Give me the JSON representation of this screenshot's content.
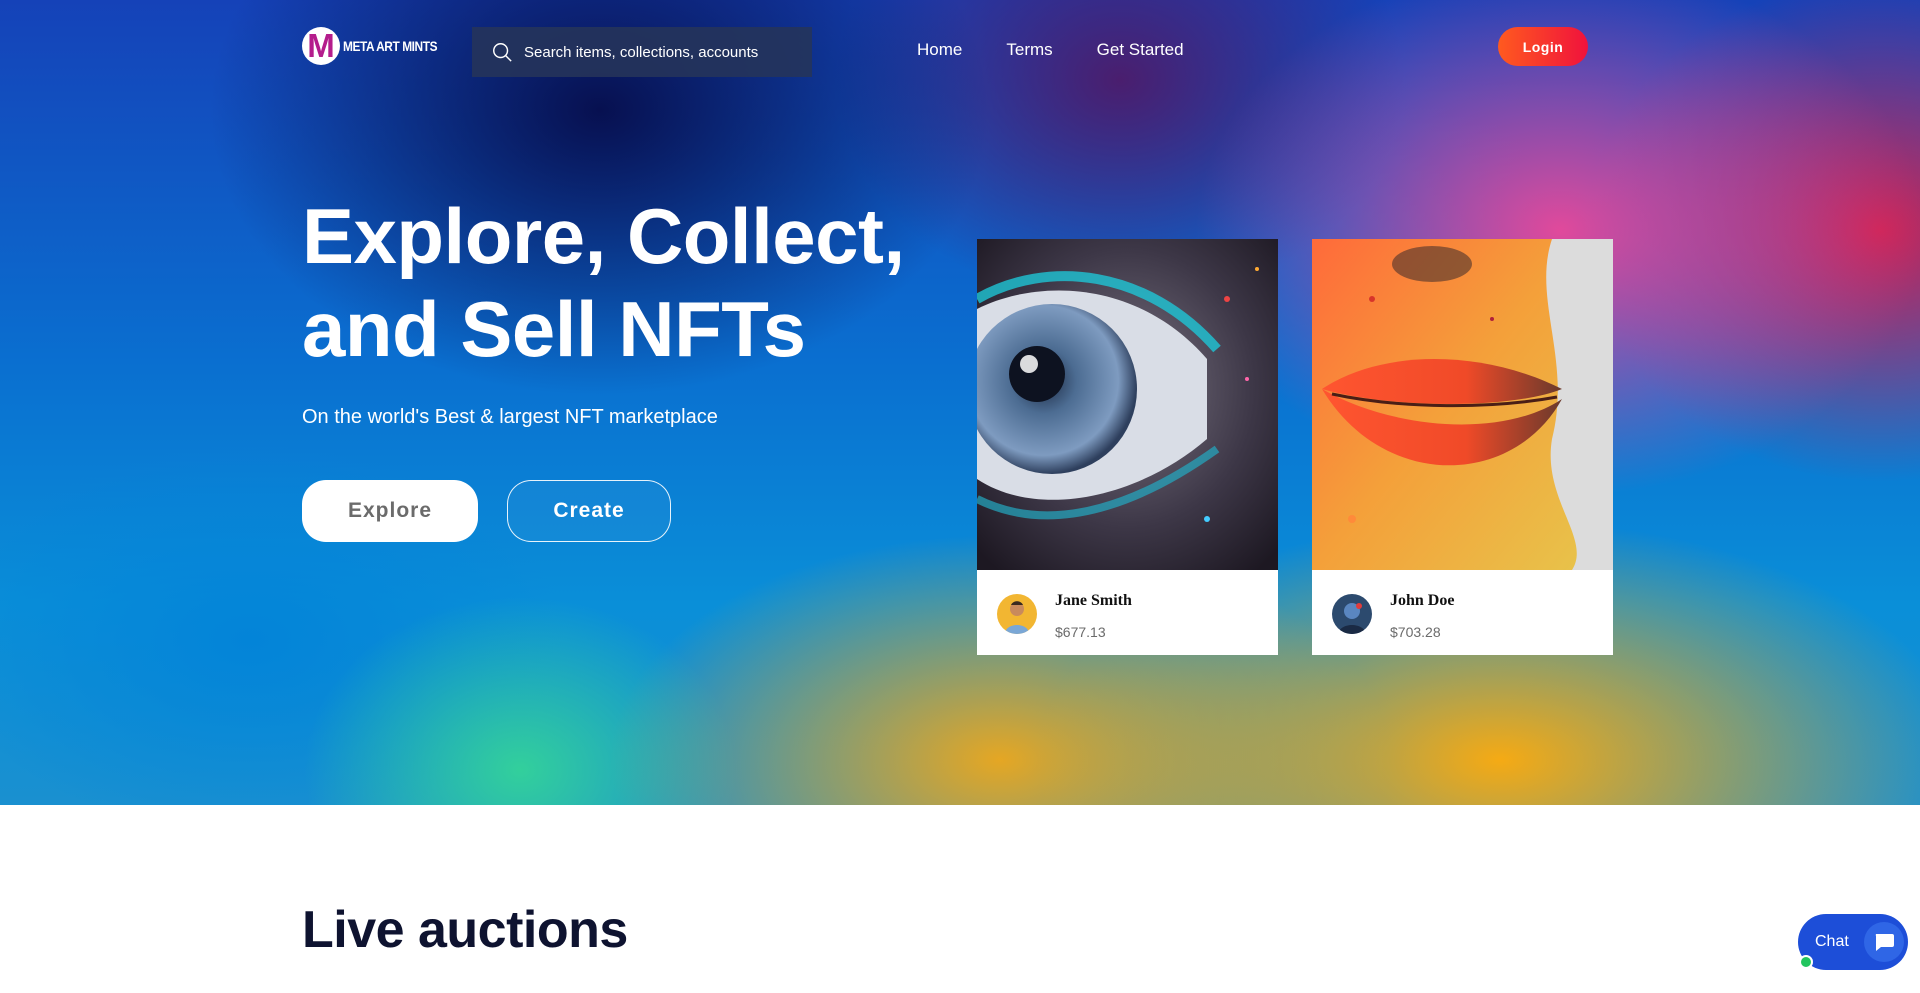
{
  "nav": {
    "logo_letter": "M",
    "logo_text": "META ART MINTS",
    "search_placeholder": "Search items, collections, accounts",
    "links": [
      "Home",
      "Terms",
      "Get Started"
    ],
    "login_label": "Login"
  },
  "hero": {
    "headline": "Explore, Collect, and Sell NFTs",
    "subtitle": "On the world's Best & largest NFT marketplace",
    "explore_label": "Explore",
    "create_label": "Create"
  },
  "cards": [
    {
      "name": "Jane Smith",
      "price": "$677.13",
      "image": "eye-artwork",
      "avatar": "jane-avatar"
    },
    {
      "name": "John Doe",
      "price": "$703.28",
      "image": "lips-artwork",
      "avatar": "john-avatar"
    }
  ],
  "sections": {
    "live_auctions_title": "Live auctions"
  },
  "chat": {
    "label": "Chat",
    "icon": "chat-bubble-icon"
  },
  "colors": {
    "login_gradient_start": "#ff5a1f",
    "login_gradient_end": "#f0123c",
    "chat_bg": "#1d4ed8",
    "online_dot": "#22c55e",
    "brand_logo": "#b41d8c"
  }
}
